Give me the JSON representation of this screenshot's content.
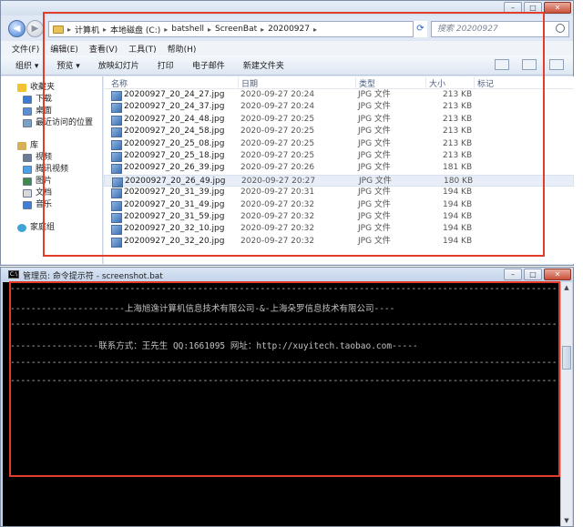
{
  "explorer": {
    "breadcrumbs": [
      "计算机",
      "本地磁盘 (C:)",
      "batshell",
      "ScreenBat",
      "20200927"
    ],
    "search_placeholder": "搜索 20200927",
    "menu": [
      "文件(F)",
      "编辑(E)",
      "查看(V)",
      "工具(T)",
      "帮助(H)"
    ],
    "toolbar": [
      "组织 ▾",
      "预览 ▾",
      "放映幻灯片",
      "打印",
      "电子邮件",
      "新建文件夹"
    ],
    "nav": {
      "favorites": {
        "label": "收藏夹",
        "items": [
          "下载",
          "桌面",
          "最近访问的位置"
        ]
      },
      "library": {
        "label": "库",
        "items": [
          "视频",
          "腾讯视频",
          "图片",
          "文档",
          "音乐"
        ]
      },
      "homegroup": "家庭组"
    },
    "columns": {
      "name": "名称",
      "date": "日期",
      "type": "类型",
      "size": "大小",
      "tags": "标记"
    },
    "files": [
      {
        "name": "20200927_20_24_27.jpg",
        "date": "2020-09-27 20:24",
        "type": "JPG 文件",
        "size": "213 KB"
      },
      {
        "name": "20200927_20_24_37.jpg",
        "date": "2020-09-27 20:24",
        "type": "JPG 文件",
        "size": "213 KB"
      },
      {
        "name": "20200927_20_24_48.jpg",
        "date": "2020-09-27 20:25",
        "type": "JPG 文件",
        "size": "213 KB"
      },
      {
        "name": "20200927_20_24_58.jpg",
        "date": "2020-09-27 20:25",
        "type": "JPG 文件",
        "size": "213 KB"
      },
      {
        "name": "20200927_20_25_08.jpg",
        "date": "2020-09-27 20:25",
        "type": "JPG 文件",
        "size": "213 KB"
      },
      {
        "name": "20200927_20_25_18.jpg",
        "date": "2020-09-27 20:25",
        "type": "JPG 文件",
        "size": "213 KB"
      },
      {
        "name": "20200927_20_26_39.jpg",
        "date": "2020-09-27 20:26",
        "type": "JPG 文件",
        "size": "181 KB"
      },
      {
        "name": "20200927_20_26_49.jpg",
        "date": "2020-09-27 20:27",
        "type": "JPG 文件",
        "size": "180 KB"
      },
      {
        "name": "20200927_20_31_39.jpg",
        "date": "2020-09-27 20:31",
        "type": "JPG 文件",
        "size": "194 KB"
      },
      {
        "name": "20200927_20_31_49.jpg",
        "date": "2020-09-27 20:32",
        "type": "JPG 文件",
        "size": "194 KB"
      },
      {
        "name": "20200927_20_31_59.jpg",
        "date": "2020-09-27 20:32",
        "type": "JPG 文件",
        "size": "194 KB"
      },
      {
        "name": "20200927_20_32_10.jpg",
        "date": "2020-09-27 20:32",
        "type": "JPG 文件",
        "size": "194 KB"
      },
      {
        "name": "20200927_20_32_20.jpg",
        "date": "2020-09-27 20:32",
        "type": "JPG 文件",
        "size": "194 KB"
      }
    ]
  },
  "cmd": {
    "title": "管理员: 命令提示符 - screenshot.bat",
    "lines": [
      "-------------------------------------------------------------------------------------------------------------",
      "----------------------上海旭逸计算机信息技术有限公司-&-上海朵罗信息技术有限公司----",
      "-------------------------------------------------------------------------------------------------------------",
      "-----------------联系方式：王先生  QQ:1661095  网址：http://xuyitech.taobao.com-----",
      "-------------------------------------------------------------------------------------------------------------",
      "-------------------------------------------------------------------------------------------------------------"
    ]
  },
  "colors": {
    "highlight": "#e23c2a",
    "console_bg": "#000000",
    "console_fg": "#c0c0c0"
  }
}
